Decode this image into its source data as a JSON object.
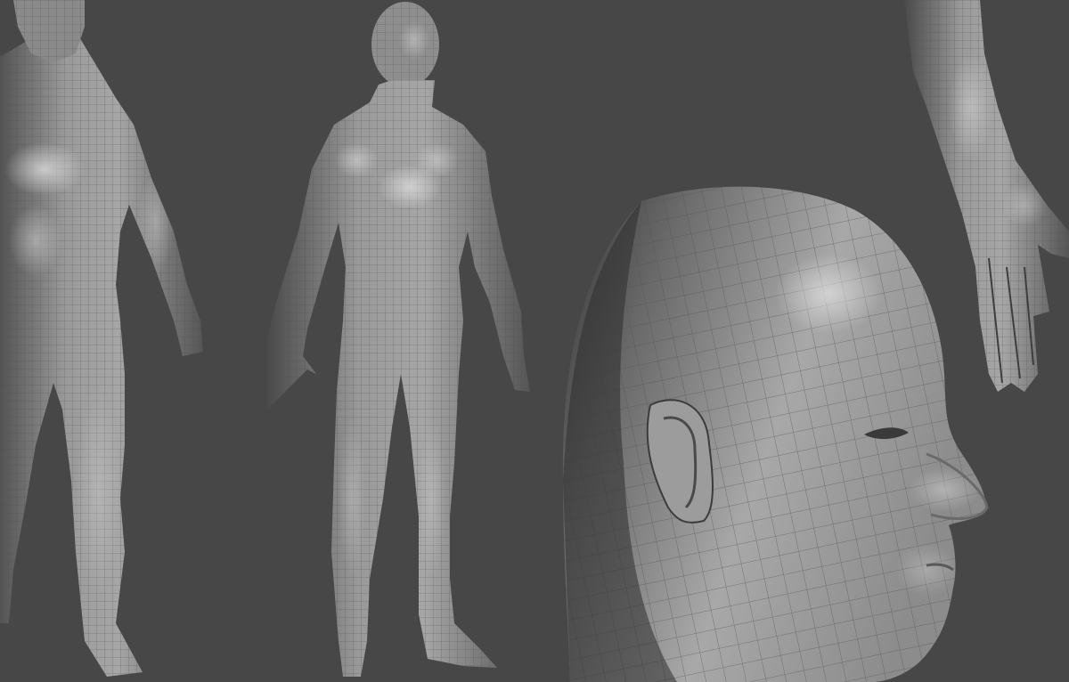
{
  "scene": {
    "background_color": "#474747",
    "mesh_base_color": "#8a8a8a",
    "mesh_highlight_color": "#c8c8c8",
    "mesh_shadow_color": "#3a3a3a",
    "wire_color": "#555555",
    "subjects": [
      "body-closeup-left",
      "body-full-center",
      "head-profile-right",
      "arm-top-right"
    ]
  }
}
